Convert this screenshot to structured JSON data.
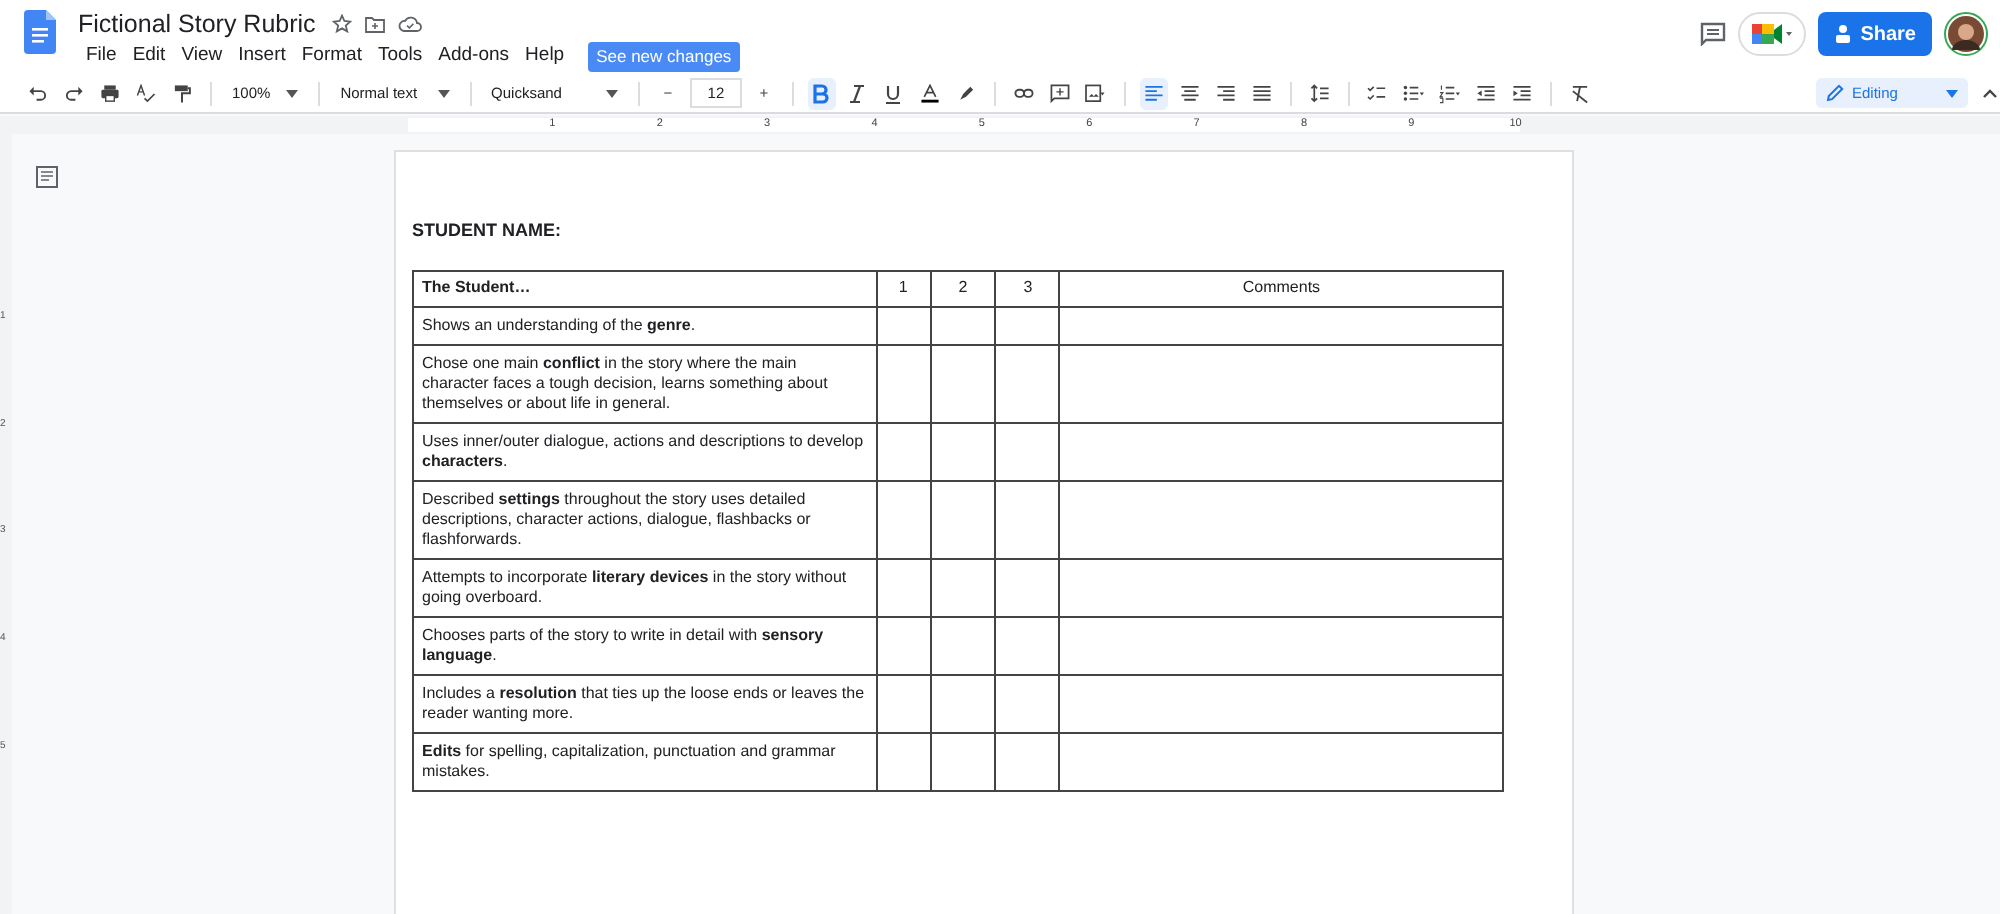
{
  "document": {
    "title": "Fictional Story Rubric"
  },
  "menu": [
    "File",
    "Edit",
    "View",
    "Insert",
    "Format",
    "Tools",
    "Add-ons",
    "Help"
  ],
  "changes_chip": "See new changes",
  "share_button": "Share",
  "toolbar": {
    "zoom": "100%",
    "style": "Normal text",
    "font": "Quicksand",
    "size": "12",
    "bold": true,
    "italic": false,
    "underline": false,
    "alignment": [
      {
        "selected": true
      },
      {
        "selected": false
      },
      {
        "selected": false
      },
      {
        "selected": false
      }
    ],
    "size_down": "−",
    "size_up": "+",
    "mode": "Editing"
  },
  "ruler": [
    "1",
    "2",
    "3",
    "4",
    "5",
    "6",
    "7",
    "8",
    "9",
    "10"
  ],
  "vertical_ruler": [
    "1",
    "2",
    "3",
    "4",
    "5"
  ],
  "heading": "STUDENT NAME:",
  "table": {
    "columns": [
      "The Student…",
      "1",
      "2",
      "3",
      "Comments"
    ],
    "rows": [
      {
        "criterion": "Shows an understanding of the **genre**."
      },
      {
        "criterion": "Chose one main **conflict** in the story where the main character faces a tough decision, learns something about themselves or about life in general."
      },
      {
        "criterion": "Uses inner/outer dialogue, actions and descriptions to develop **characters**."
      },
      {
        "criterion": "Described **settings** throughout the story uses detailed descriptions, character actions, dialogue, flashbacks or flashforwards."
      },
      {
        "criterion": "Attempts to incorporate **literary devices** in the story without going overboard."
      },
      {
        "criterion": "Chooses parts of the story to write in detail with **sensory language**."
      },
      {
        "criterion": "Includes a **resolution** that ties up the loose ends or leaves the reader wanting more."
      },
      {
        "criterion": "**Edits** for spelling, capitalization, punctuation and grammar mistakes."
      }
    ]
  }
}
